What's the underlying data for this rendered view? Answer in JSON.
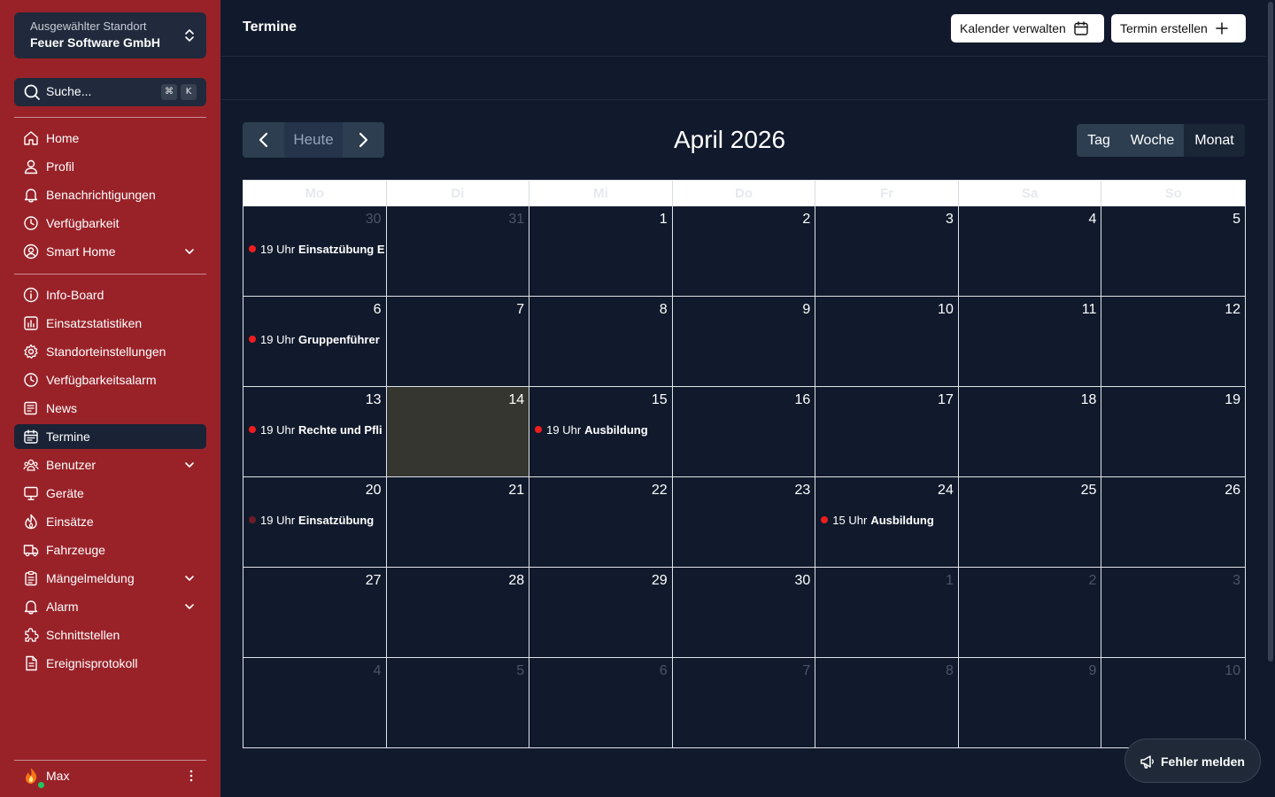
{
  "sidebar": {
    "location_label": "Ausgewählter Standort",
    "location_name": "Feuer Software GmbH",
    "search_placeholder": "Suche...",
    "shortcut_mod": "⌘",
    "shortcut_key": "K",
    "items_top": [
      {
        "label": "Home",
        "icon": "home-icon"
      },
      {
        "label": "Profil",
        "icon": "user-icon"
      },
      {
        "label": "Benachrichtigungen",
        "icon": "bell-icon"
      },
      {
        "label": "Verfügbarkeit",
        "icon": "clock-icon"
      },
      {
        "label": "Smart Home",
        "icon": "user-circle-icon",
        "expandable": true
      }
    ],
    "items_main": [
      {
        "label": "Info-Board",
        "icon": "info-icon"
      },
      {
        "label": "Einsatzstatistiken",
        "icon": "chart-icon"
      },
      {
        "label": "Standorteinstellungen",
        "icon": "gear-icon"
      },
      {
        "label": "Verfügbarkeitsalarm",
        "icon": "clock-icon"
      },
      {
        "label": "News",
        "icon": "newspaper-icon"
      },
      {
        "label": "Termine",
        "icon": "calendar-icon",
        "active": true
      },
      {
        "label": "Benutzer",
        "icon": "users-icon",
        "expandable": true
      },
      {
        "label": "Geräte",
        "icon": "device-icon"
      },
      {
        "label": "Einsätze",
        "icon": "fire-icon"
      },
      {
        "label": "Fahrzeuge",
        "icon": "truck-icon"
      },
      {
        "label": "Mängelmeldung",
        "icon": "clipboard-icon",
        "expandable": true
      },
      {
        "label": "Alarm",
        "icon": "bell-icon",
        "expandable": true
      },
      {
        "label": "Schnittstellen",
        "icon": "puzzle-icon"
      },
      {
        "label": "Ereignisprotokoll",
        "icon": "document-icon"
      }
    ],
    "user_name": "Max"
  },
  "header": {
    "title": "Termine",
    "manage_label": "Kalender verwalten",
    "create_label": "Termin erstellen"
  },
  "toolbar": {
    "today_label": "Heute",
    "calendar_title": "April 2026",
    "views": [
      "Tag",
      "Woche",
      "Monat"
    ],
    "active_view": "Monat"
  },
  "calendar": {
    "weekdays": [
      "Mo",
      "Di",
      "Mi",
      "Do",
      "Fr",
      "Sa",
      "So"
    ],
    "weeks": [
      [
        {
          "d": "30",
          "o": true
        },
        {
          "d": "31",
          "o": true
        },
        {
          "d": "1"
        },
        {
          "d": "2"
        },
        {
          "d": "3"
        },
        {
          "d": "4"
        },
        {
          "d": "5"
        }
      ],
      [
        {
          "d": "6"
        },
        {
          "d": "7"
        },
        {
          "d": "8"
        },
        {
          "d": "9"
        },
        {
          "d": "10"
        },
        {
          "d": "11"
        },
        {
          "d": "12"
        }
      ],
      [
        {
          "d": "13"
        },
        {
          "d": "14",
          "today": true
        },
        {
          "d": "15"
        },
        {
          "d": "16"
        },
        {
          "d": "17"
        },
        {
          "d": "18"
        },
        {
          "d": "19"
        }
      ],
      [
        {
          "d": "20"
        },
        {
          "d": "21"
        },
        {
          "d": "22"
        },
        {
          "d": "23"
        },
        {
          "d": "24"
        },
        {
          "d": "25"
        },
        {
          "d": "26"
        }
      ],
      [
        {
          "d": "27"
        },
        {
          "d": "28"
        },
        {
          "d": "29"
        },
        {
          "d": "30"
        },
        {
          "d": "1",
          "o": true
        },
        {
          "d": "2",
          "o": true
        },
        {
          "d": "3",
          "o": true
        }
      ],
      [
        {
          "d": "4",
          "o": true
        },
        {
          "d": "5",
          "o": true
        },
        {
          "d": "6",
          "o": true
        },
        {
          "d": "7",
          "o": true
        },
        {
          "d": "8",
          "o": true
        },
        {
          "d": "9",
          "o": true
        },
        {
          "d": "10",
          "o": true
        }
      ]
    ],
    "events": [
      {
        "week": 0,
        "day": 0,
        "time": "19 Uhr",
        "title": "Einsatzübung E",
        "dot_color": "#ef1d1d"
      },
      {
        "week": 1,
        "day": 0,
        "time": "19 Uhr",
        "title": "Gruppenführer",
        "dot_color": "#ef1d1d"
      },
      {
        "week": 2,
        "day": 0,
        "time": "19 Uhr",
        "title": "Rechte und Pfli",
        "dot_color": "#ef1d1d"
      },
      {
        "week": 2,
        "day": 2,
        "time": "19 Uhr",
        "title": "Ausbildung",
        "dot_color": "#ef1d1d"
      },
      {
        "week": 3,
        "day": 0,
        "time": "19 Uhr",
        "title": "Einsatzübung",
        "dot_color": "#6d1d27"
      },
      {
        "week": 3,
        "day": 4,
        "time": "15 Uhr",
        "title": "Ausbildung",
        "dot_color": "#ef1d1d"
      }
    ]
  },
  "report_button_label": "Fehler melden"
}
